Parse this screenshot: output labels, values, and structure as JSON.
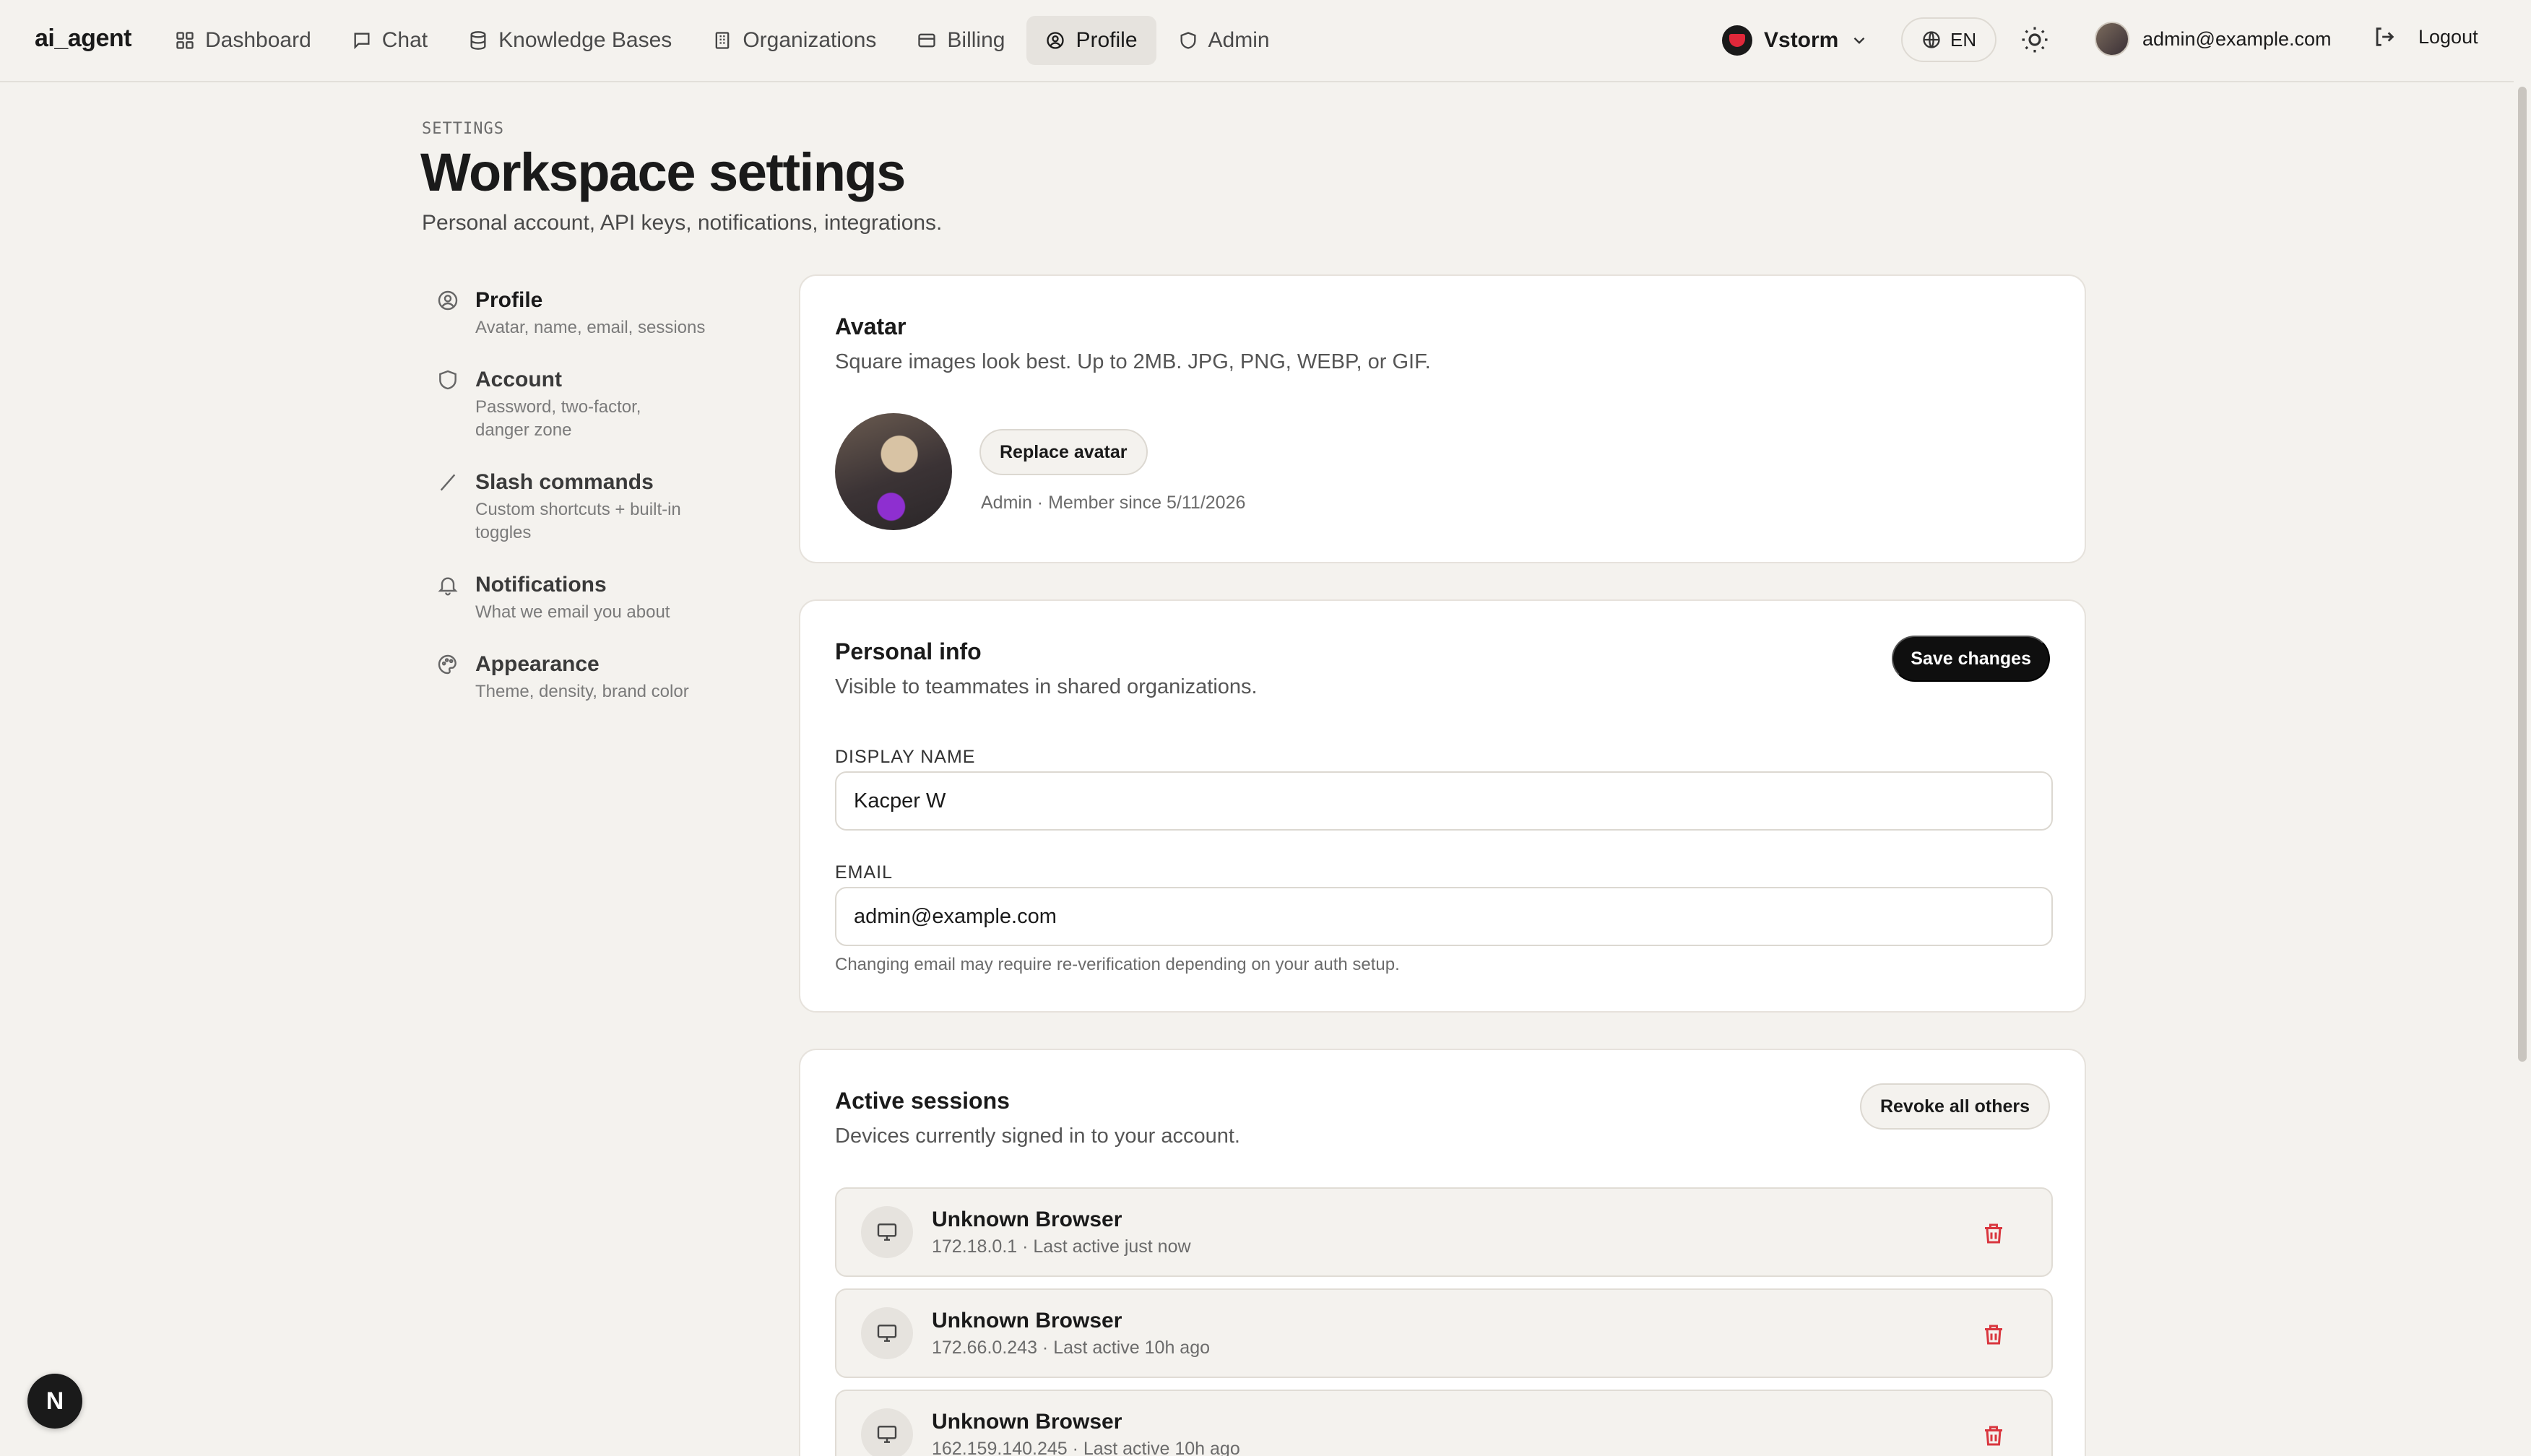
{
  "app": {
    "brand": "ai_agent"
  },
  "nav": {
    "items": [
      {
        "label": "Dashboard",
        "icon": "grid-icon"
      },
      {
        "label": "Chat",
        "icon": "chat-icon"
      },
      {
        "label": "Knowledge Bases",
        "icon": "database-icon"
      },
      {
        "label": "Organizations",
        "icon": "building-icon"
      },
      {
        "label": "Billing",
        "icon": "card-icon"
      },
      {
        "label": "Profile",
        "icon": "user-circle-icon",
        "active": true
      },
      {
        "label": "Admin",
        "icon": "shield-icon"
      }
    ],
    "org": "Vstorm",
    "language": "EN",
    "user_email": "admin@example.com",
    "logout": "Logout"
  },
  "header": {
    "eyebrow": "SETTINGS",
    "title": "Workspace settings",
    "subtitle": "Personal account, API keys, notifications, integrations."
  },
  "settings_nav": [
    {
      "title": "Profile",
      "desc": "Avatar, name, email, sessions",
      "icon": "user-circle-icon",
      "active": true
    },
    {
      "title": "Account",
      "desc": "Password, two-factor, danger zone",
      "icon": "shield-icon"
    },
    {
      "title": "Slash commands",
      "desc": "Custom shortcuts + built-in toggles",
      "icon": "slash-icon"
    },
    {
      "title": "Notifications",
      "desc": "What we email you about",
      "icon": "bell-icon"
    },
    {
      "title": "Appearance",
      "desc": "Theme, density, brand color",
      "icon": "palette-icon"
    }
  ],
  "avatar_card": {
    "title": "Avatar",
    "subtitle": "Square images look best. Up to 2MB. JPG, PNG, WEBP, or GIF.",
    "replace_label": "Replace avatar",
    "member_line": "Admin · Member since 5/11/2026"
  },
  "personal_info": {
    "title": "Personal info",
    "subtitle": "Visible to teammates in shared organizations.",
    "save_label": "Save changes",
    "display_name_label": "DISPLAY NAME",
    "display_name_value": "Kacper W",
    "email_label": "EMAIL",
    "email_value": "admin@example.com",
    "email_hint": "Changing email may require re-verification depending on your auth setup."
  },
  "sessions": {
    "title": "Active sessions",
    "subtitle": "Devices currently signed in to your account.",
    "revoke_label": "Revoke all others",
    "items": [
      {
        "name": "Unknown Browser",
        "meta": "172.18.0.1 · Last active just now"
      },
      {
        "name": "Unknown Browser",
        "meta": "172.66.0.243 · Last active 10h ago"
      },
      {
        "name": "Unknown Browser",
        "meta": "162.159.140.245 · Last active 10h ago"
      }
    ]
  },
  "badge": {
    "letter": "N"
  },
  "colors": {
    "background": "#f4f2ee",
    "danger": "#d9363e",
    "primary": "#0f0f0f"
  }
}
